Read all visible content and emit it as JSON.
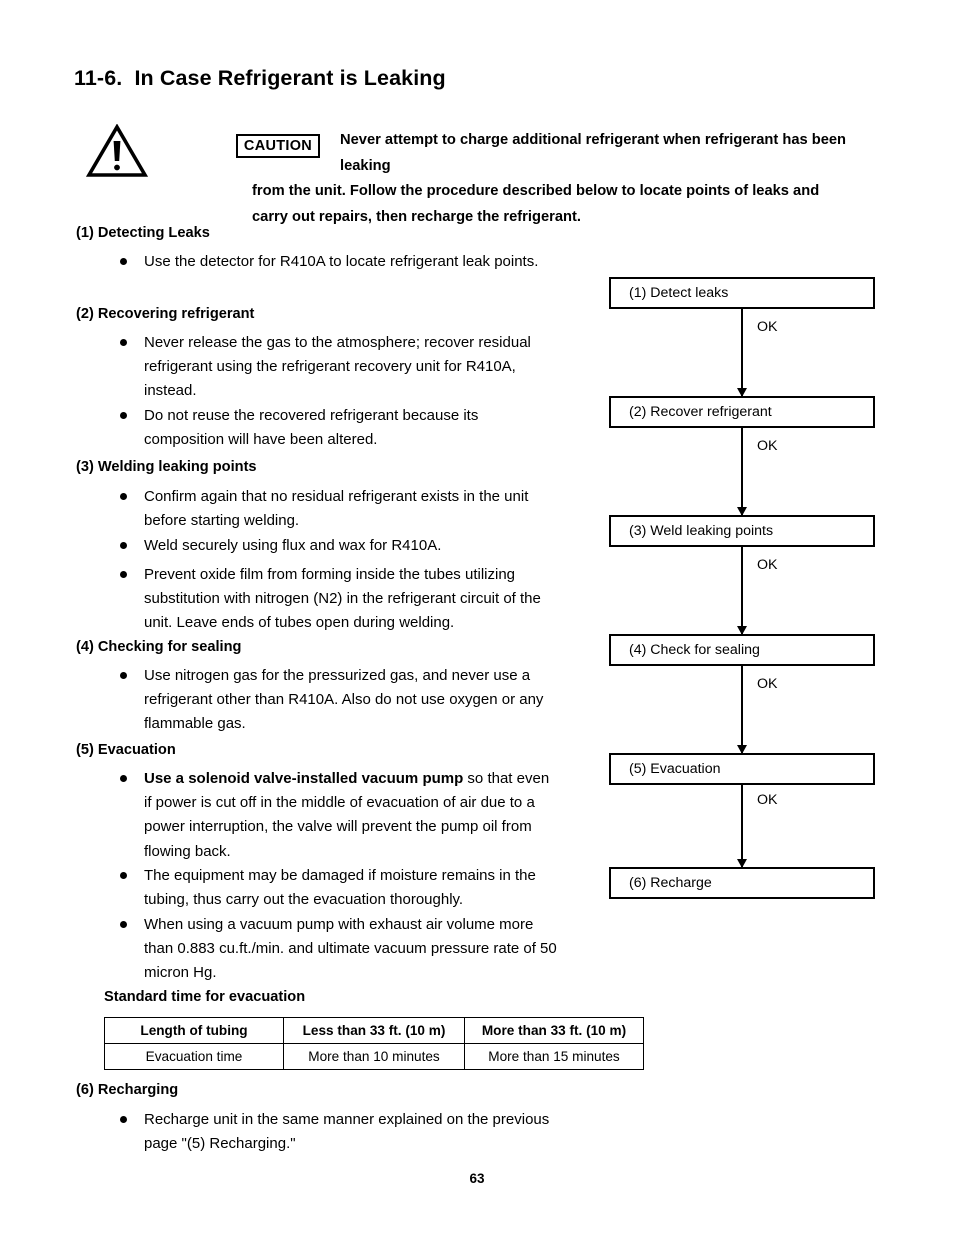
{
  "document": {
    "section_number": "11-6.",
    "section_title": "In Case Refrigerant is Leaking",
    "heading_full": "11-6.  In Case Refrigerant is Leaking",
    "page_number": "63"
  },
  "caution": {
    "badge_label": "CAUTION",
    "icon": "warning-triangle-icon",
    "lines": [
      "Never attempt to charge additional refrigerant when refrigerant has been leaking",
      "from the unit. Follow the procedure described below to locate points of leaks and",
      "carry out repairs, then recharge the refrigerant."
    ]
  },
  "sections": [
    {
      "heading": "(1) Detecting Leaks",
      "bullets": [
        {
          "text": "Use the detector for R410A to locate refrigerant leak points."
        }
      ]
    },
    {
      "heading": "(2) Recovering refrigerant",
      "bullets": [
        {
          "text": "Never release the gas to the atmosphere; recover residual refrigerant using the refrigerant recovery unit for R410A, instead."
        },
        {
          "text": "Do not reuse the recovered refrigerant because its composition will have been altered."
        }
      ]
    },
    {
      "heading": "(3) Welding leaking points",
      "bullets": [
        {
          "text": "Confirm again that no residual refrigerant exists in the unit before starting welding."
        },
        {
          "text": "Weld securely using flux and wax for R410A."
        },
        {
          "text": "Prevent oxide film from forming inside the tubes utilizing substitution with nitrogen (N2) in the refrigerant circuit of the unit. Leave ends of tubes open during welding."
        }
      ]
    },
    {
      "heading": "(4) Checking for sealing",
      "bullets": [
        {
          "text": "Use nitrogen gas for the pressurized gas, and never use a refrigerant other than R410A. Also do not use oxygen or any flammable gas."
        }
      ]
    },
    {
      "heading": "(5) Evacuation",
      "bullets": [
        {
          "bold_lead": "Use a solenoid valve-installed vacuum pump",
          "text": " so that even if power is cut off in the middle of evacuation of air due to a power interruption, the valve will prevent the pump oil from flowing back."
        },
        {
          "text": "The equipment may be damaged if moisture remains in the tubing, thus carry out the evacuation thoroughly."
        },
        {
          "text": "When using a vacuum pump with exhaust air volume more than 0.883 cu.ft./min. and ultimate vacuum pressure rate of 50 micron Hg."
        }
      ]
    },
    {
      "heading": "(6) Recharging",
      "bullets": [
        {
          "text": "Recharge unit in the same manner explained on the previous page \"(5) Recharging.\""
        }
      ]
    }
  ],
  "evacuation_table": {
    "caption": "Standard time for evacuation",
    "headers": [
      "Length of tubing",
      "Less than 33 ft. (10 m)",
      "More than  33 ft. (10 m)"
    ],
    "rows": [
      [
        "Evacuation time",
        "More than 10 minutes",
        "More than 15 minutes"
      ]
    ]
  },
  "flowchart": {
    "steps": [
      {
        "label": "(1) Detect leaks"
      },
      {
        "label": "(2) Recover refrigerant"
      },
      {
        "label": "(3) Weld leaking points"
      },
      {
        "label": "(4) Check for sealing"
      },
      {
        "label": "(5) Evacuation"
      },
      {
        "label": "(6) Recharge"
      }
    ],
    "connector_labels": [
      "OK",
      "OK",
      "OK",
      "OK",
      "OK"
    ]
  }
}
